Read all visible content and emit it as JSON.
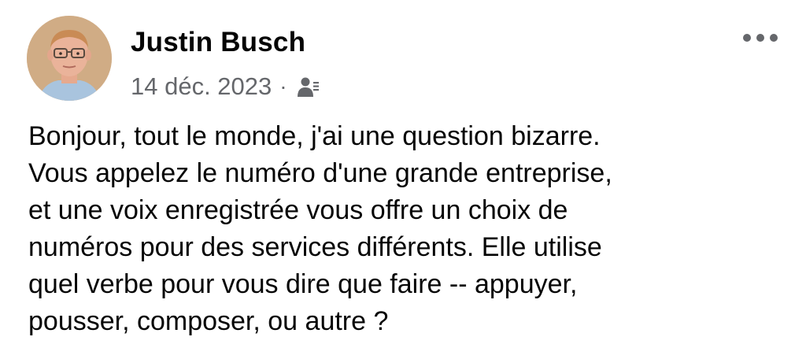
{
  "post": {
    "author_name": "Justin Busch",
    "date": "14 déc. 2023",
    "separator": "·",
    "audience_icon": "friends-icon",
    "more_icon": "more-options-icon",
    "body_lines": [
      "Bonjour, tout le monde, j'ai une question bizarre.",
      "Vous appelez le numéro d'une grande entreprise,",
      "et une voix enregistrée vous offre un choix de",
      "numéros pour des services différents. Elle utilise",
      "quel verbe pour vous dire que faire -- appuyer,",
      "pousser, composer, ou autre ?"
    ]
  },
  "colors": {
    "text": "#050505",
    "secondary_text": "#65676b",
    "background": "#ffffff"
  }
}
